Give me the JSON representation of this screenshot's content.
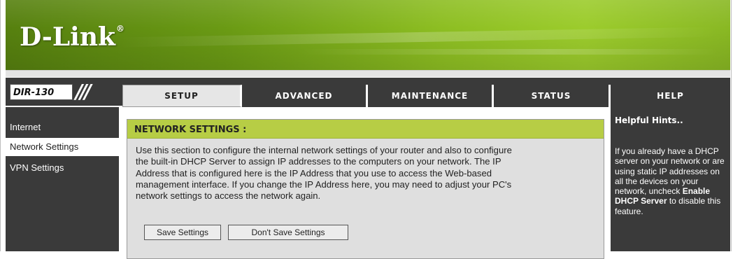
{
  "brand": {
    "logo": "D-Link",
    "registered": "®",
    "model": "DIR-130",
    "model_slash": "///"
  },
  "nav": {
    "tabs": [
      {
        "label": "SETUP",
        "active": true
      },
      {
        "label": "ADVANCED",
        "active": false
      },
      {
        "label": "MAINTENANCE",
        "active": false
      },
      {
        "label": "STATUS",
        "active": false
      }
    ],
    "help": "HELP"
  },
  "sidebar": {
    "items": [
      {
        "label": "Internet",
        "active": false
      },
      {
        "label": "Network Settings",
        "active": true
      },
      {
        "label": "VPN Settings",
        "active": false
      }
    ]
  },
  "main": {
    "section_title": "NETWORK SETTINGS :",
    "lines": [
      "Use this section to configure the internal network settings of your router and also to configure",
      "the built-in DHCP Server to assign IP addresses to the computers on your network. The IP",
      "Address that is configured here is the IP Address that you use to access the Web-based",
      "management interface. If you change the IP Address here, you may need to adjust your PC's",
      "network settings to access the network again."
    ],
    "save_label": "Save Settings",
    "dont_save_label": "Don't Save Settings"
  },
  "hints": {
    "title": "Helpful Hints..",
    "text_1": "If you already have a DHCP server on your network or are using static IP addresses on all the devices on your network, uncheck ",
    "bold": "Enable DHCP Server",
    "text_2": " to disable this feature."
  },
  "colors": {
    "banner_green": "#6a9a14",
    "dark_nav": "#3a3a3a",
    "section_header": "#b7cd45",
    "panel_bg": "#dfdfdf"
  }
}
